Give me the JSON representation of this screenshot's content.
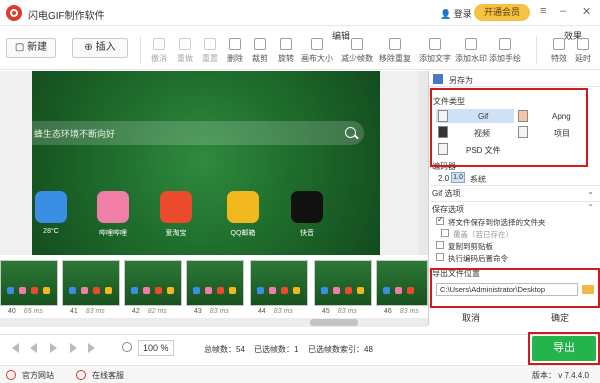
{
  "app": {
    "title": "闪电GIF制作软件",
    "login": "登录",
    "member": "开通会员"
  },
  "toolbar": {
    "new_label": "新建",
    "insert_label": "插入",
    "edit_section": "编辑",
    "effects_section": "效果",
    "tools": [
      "撤消",
      "重做",
      "重置",
      "删除",
      "裁剪",
      "旋转",
      "画布大小",
      "减少帧数",
      "移除重复",
      "添加文字",
      "添加水印",
      "添加手绘"
    ],
    "effects": [
      "特效",
      "延时"
    ]
  },
  "preview": {
    "search_text": "蜂生态环境不断向好",
    "apps": [
      {
        "name": "28°C",
        "color": "#3a8ee6"
      },
      {
        "name": "哔哩哔哩",
        "color": "#f07ea6"
      },
      {
        "name": "爱淘宝",
        "color": "#e94b2c"
      },
      {
        "name": "QQ邮箱",
        "color": "#f2b81d"
      },
      {
        "name": "快音",
        "color": "#111111"
      }
    ]
  },
  "filmstrip": {
    "frames": [
      {
        "num": "40",
        "ms": "65 ms"
      },
      {
        "num": "41",
        "ms": "83 ms"
      },
      {
        "num": "42",
        "ms": "82 ms"
      },
      {
        "num": "43",
        "ms": "83 ms"
      },
      {
        "num": "44",
        "ms": "83 ms"
      },
      {
        "num": "45",
        "ms": "83 ms"
      },
      {
        "num": "46",
        "ms": "83 ms"
      }
    ]
  },
  "bottom": {
    "zoom": "100 %",
    "total_frames": "总帧数：54",
    "selected_frames": "已选帧数：1",
    "selected_index": "已选帧数索引：48",
    "export_label": "导出"
  },
  "status": {
    "website": "官方网站",
    "support": "在线客服",
    "version": "版本： v 7.4.4.0"
  },
  "dialog": {
    "title": "另存为",
    "file_type_label": "文件类型",
    "formats": [
      "Gif",
      "Apng",
      "视频",
      "项目",
      "PSD 文件"
    ],
    "quality_label": "编码器",
    "quality_opts": [
      "2.0",
      "1.0"
    ],
    "quality_suffix": "系统",
    "gif_options": "Gif 选项",
    "save_options": "保存选项",
    "save_checks": [
      {
        "label": "将文件保存到你选择的文件夹",
        "checked": true,
        "dim": false
      },
      {
        "label": "覆盖（若已存在）",
        "checked": false,
        "dim": true
      },
      {
        "label": "复制到剪贴板",
        "checked": false,
        "dim": false
      },
      {
        "label": "执行编码后置命令",
        "checked": false,
        "dim": false
      }
    ],
    "export_location": "导出文件位置",
    "path": "C:\\Users\\Administrator\\Desktop",
    "cancel": "取消",
    "ok": "确定"
  }
}
